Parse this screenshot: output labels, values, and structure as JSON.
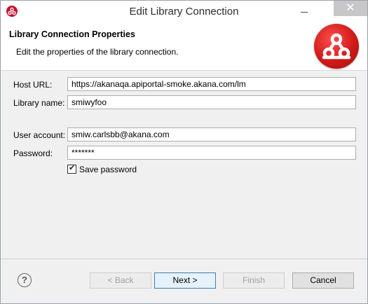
{
  "window": {
    "title": "Edit Library Connection",
    "close_symbol": "✕"
  },
  "header": {
    "title": "Library Connection Properties",
    "description": "Edit the properties of the library connection."
  },
  "form": {
    "host_url": {
      "label": "Host URL:",
      "value": "https://akanaqa.apiportal-smoke.akana.com/lm"
    },
    "library_name": {
      "label": "Library name:",
      "value": "smiwyfoo"
    },
    "user_account": {
      "label": "User account:",
      "value": "smiw.carlsbb@akana.com"
    },
    "password": {
      "label": "Password:",
      "value": "*******"
    },
    "save_password": {
      "label": "Save password",
      "checked": true
    }
  },
  "footer": {
    "help_symbol": "?",
    "back_label": "< Back",
    "next_label": "Next >",
    "finish_label": "Finish",
    "cancel_label": "Cancel"
  },
  "colors": {
    "brand_red": "#d11a1a",
    "primary_border": "#3c7fb1"
  },
  "icons": [
    "app-logo-icon",
    "minimize-icon",
    "close-icon",
    "akana-logo-icon",
    "checkmark-icon",
    "help-icon"
  ]
}
